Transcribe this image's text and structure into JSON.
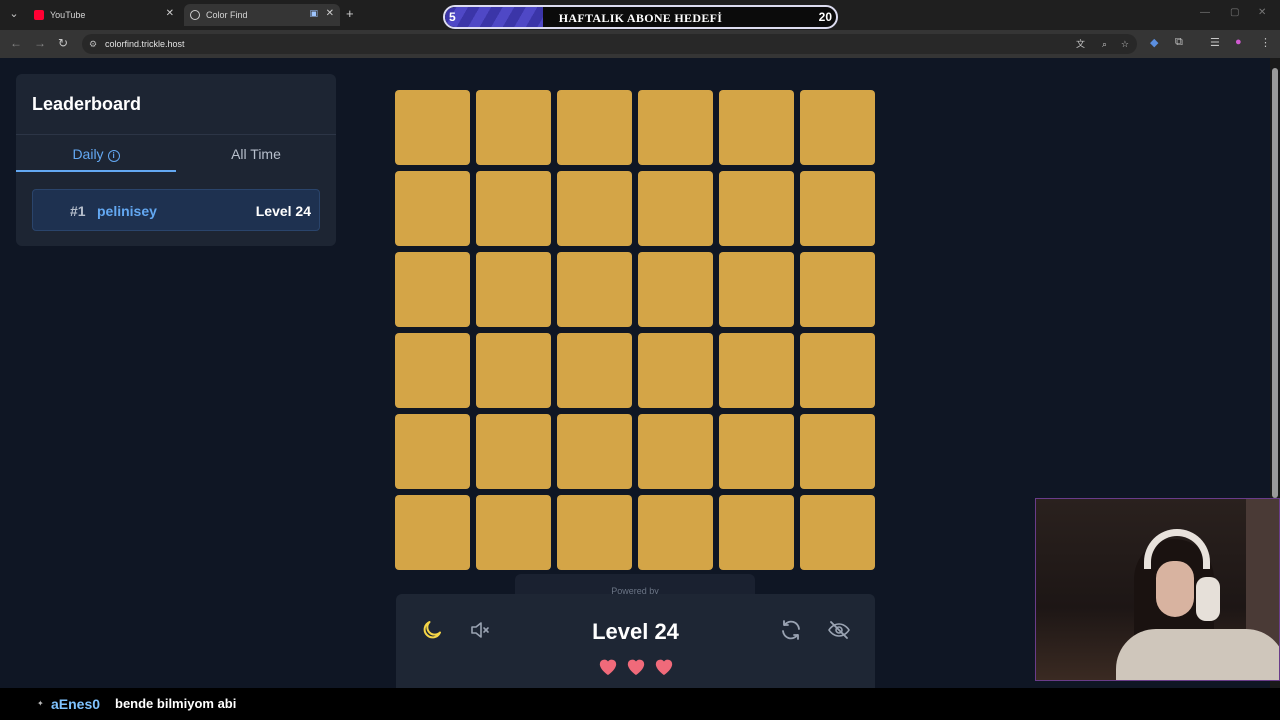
{
  "browser": {
    "tabs": [
      {
        "title": "YouTube",
        "active": false
      },
      {
        "title": "Color Find",
        "active": true
      }
    ],
    "url": "colorfind.trickle.host"
  },
  "overlay_goal": {
    "title": "HAFTALIK ABONE HEDEFİ",
    "current": "5",
    "target": "20",
    "progress_fraction": 0.25
  },
  "leaderboard": {
    "title": "Leaderboard",
    "tabs": [
      {
        "label": "Daily",
        "active": true
      },
      {
        "label": "All Time",
        "active": false
      }
    ],
    "entries": [
      {
        "rank": "#1",
        "name": "pelinisey",
        "level": "Level 24"
      }
    ]
  },
  "game": {
    "grid_rows": 6,
    "grid_cols": 6,
    "tile_color": "#d4a547",
    "powered_by": "Powered by",
    "level": "Level 24",
    "lives": 3,
    "heart_color": "#f06a7a",
    "icons": [
      "moon-icon",
      "mute-icon",
      "refresh-icon",
      "eye-off-icon"
    ]
  },
  "chat": {
    "username": "aEnes0",
    "message": "bende bilmiyom abi"
  },
  "colors": {
    "page_bg": "#0f1624",
    "panel_bg": "#1e2634",
    "accent_blue": "#63a8f2",
    "moon_yellow": "#f5d547"
  }
}
